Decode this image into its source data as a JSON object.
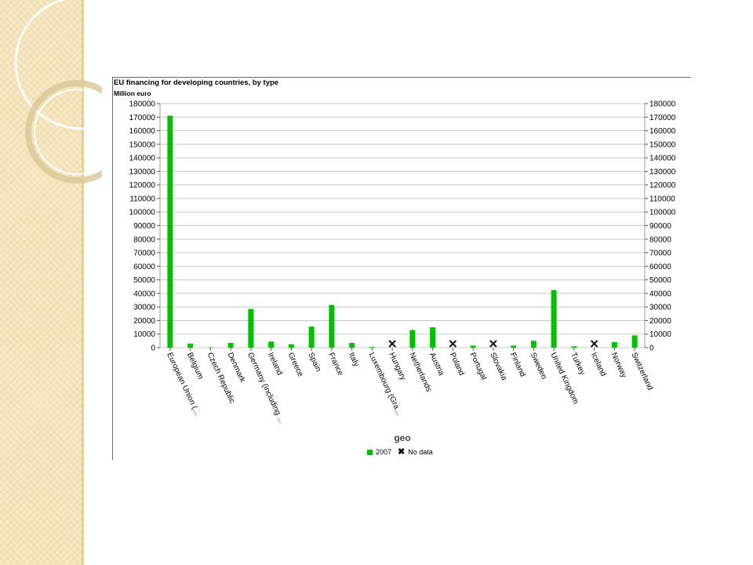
{
  "slide": {
    "band_color": "#f6e8c4"
  },
  "chart_data": {
    "type": "bar",
    "title": "EU financing for developing countries, by type",
    "unit_label": "Million euro",
    "xlabel": "geo",
    "ylabel": "",
    "ylim": [
      0,
      180000
    ],
    "ytick_step": 10000,
    "grid": true,
    "dual_y_axis": true,
    "legend_position": "bottom",
    "categories": [
      "European Union (...",
      "Belgium",
      "Czech Republic",
      "Denmark",
      "Germany (including ...",
      "Ireland",
      "Greece",
      "Spain",
      "France",
      "Italy",
      "Luxembourg (Gra...",
      "Hungary",
      "Netherlands",
      "Austria",
      "Poland",
      "Portugal",
      "Slovakia",
      "Finland",
      "Sweden",
      "United Kingdom",
      "Turkey",
      "Iceland",
      "Norway",
      "Switzerland"
    ],
    "series": [
      {
        "name": "2007",
        "color": "#00c000",
        "values": [
          171000,
          3000,
          200,
          3500,
          28500,
          4500,
          2500,
          15500,
          31500,
          3500,
          500,
          null,
          13000,
          15000,
          null,
          1500,
          null,
          1500,
          5000,
          42500,
          1000,
          null,
          4000,
          9000
        ]
      }
    ],
    "no_data_label": "No data",
    "no_data_color": "#1a1a1a"
  }
}
